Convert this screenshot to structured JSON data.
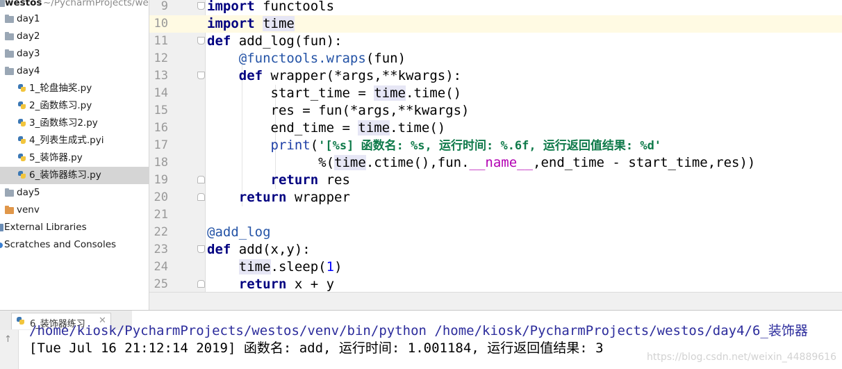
{
  "project_tree": {
    "root": {
      "name": "westos",
      "path": "~/PycharmProjects/westos"
    },
    "items": [
      {
        "label": "day1",
        "type": "folder"
      },
      {
        "label": "day2",
        "type": "folder"
      },
      {
        "label": "day3",
        "type": "folder"
      },
      {
        "label": "day4",
        "type": "folder"
      },
      {
        "label": "1_轮盘抽奖.py",
        "type": "python-file"
      },
      {
        "label": "2_函数练习.py",
        "type": "python-file"
      },
      {
        "label": "3_函数练习2.py",
        "type": "python-file"
      },
      {
        "label": "4_列表生成式.pyi",
        "type": "python-file"
      },
      {
        "label": "5_装饰器.py",
        "type": "python-file"
      },
      {
        "label": "6_装饰器练习.py",
        "type": "python-file",
        "selected": true
      },
      {
        "label": "day5",
        "type": "folder"
      },
      {
        "label": "venv",
        "type": "folder-orange"
      },
      {
        "label": "External Libraries",
        "type": "library"
      },
      {
        "label": "Scratches and Consoles",
        "type": "scratch"
      }
    ]
  },
  "editor": {
    "current_line": 10,
    "line_numbers": [
      "9",
      "10",
      "11",
      "12",
      "13",
      "14",
      "15",
      "16",
      "17",
      "18",
      "19",
      "20",
      "21",
      "22",
      "23",
      "24",
      "25"
    ],
    "tokens": {
      "import": "import",
      "def": "def",
      "return": "return",
      "functools": "functools",
      "time": "time",
      "add_log_sig": "add_log(fun):",
      "at_sign": "@",
      "functools_dot": "functools.",
      "wraps": "wraps",
      "fun_paren": "(fun)",
      "wrapper_sig": "wrapper(*args,**kwargs):",
      "start_time_eq": "start_time = ",
      "dot_time_call": ".time()",
      "res_eq": "res = fun(*args,**kwargs)",
      "end_time_eq": "end_time = ",
      "print": "print",
      "open_paren": "(",
      "format_string": "'[%s] 函数名: %s, 运行时间: %.6f, 运行返回值结果: %d'",
      "percent_paren": "%(",
      "ctime_fun": ".ctime(),fun.",
      "dunder_name": "__name__",
      "tail_args": ",end_time - start_time,res))",
      "res": "res",
      "wrapper": "wrapper",
      "decorator_add_log": "add_log",
      "add_sig": "add(x,y):",
      "dot_sleep": ".sleep(",
      "one": "1",
      "close_paren": ")",
      "x_plus_y": "x + y"
    }
  },
  "run_panel": {
    "tab_label": "6_装饰器练习",
    "command_line": "/home/kiosk/PycharmProjects/westos/venv/bin/python /home/kiosk/PycharmProjects/westos/day4/6_装饰器",
    "output_line": "[Tue Jul 16 21:12:14 2019] 函数名: add, 运行时间: 1.001184, 运行返回值结果: 3"
  },
  "watermark": "https://blog.csdn.net/weixin_44889616",
  "colors": {
    "keyword": "#000080",
    "string": "#0f7a4a",
    "decorator": "#2453a6",
    "dunder": "#b200b2",
    "number": "#0000ff",
    "current_line_bg": "#fffae3",
    "selection_bg": "#d5d5d5"
  }
}
